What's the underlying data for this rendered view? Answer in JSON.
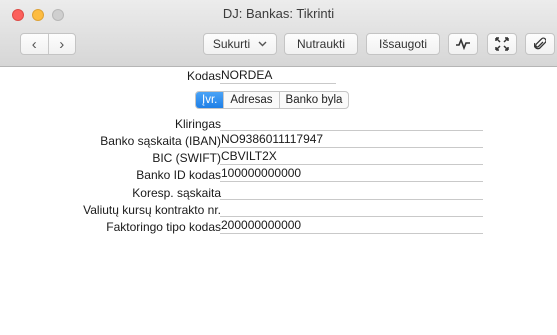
{
  "window": {
    "title": "DJ: Bankas: Tikrinti"
  },
  "toolbar": {
    "back_symbol": "‹",
    "forward_symbol": "›",
    "create_label": "Sukurti",
    "cancel_label": "Nutraukti",
    "save_label": "Išsaugoti",
    "icons": [
      "activity-icon",
      "expand-icon",
      "paperclip-icon"
    ]
  },
  "header": {
    "code_label": "Kodas",
    "code_value": "NORDEA"
  },
  "tabs": [
    {
      "label": "Įvr.",
      "active": true
    },
    {
      "label": "Adresas",
      "active": false
    },
    {
      "label": "Banko byla",
      "active": false
    }
  ],
  "fields": [
    {
      "label": "Kliringas",
      "value": ""
    },
    {
      "label": "Banko sąskaita (IBAN)",
      "value": "NO9386011117947"
    },
    {
      "label": "BIC (SWIFT)",
      "value": "CBVILT2X"
    },
    {
      "label": "Banko ID kodas",
      "value": "100000000000"
    },
    {
      "label": "Koresp. sąskaita",
      "value": ""
    },
    {
      "label": "Valiutų kursų kontrakto nr.",
      "value": ""
    },
    {
      "label": "Faktoringo tipo kodas",
      "value": "200000000000"
    }
  ],
  "colors": {
    "accent": "#1e7fe6",
    "close": "#fc605c",
    "minimize": "#fdbc40",
    "maximize": "#cfcfcf"
  }
}
